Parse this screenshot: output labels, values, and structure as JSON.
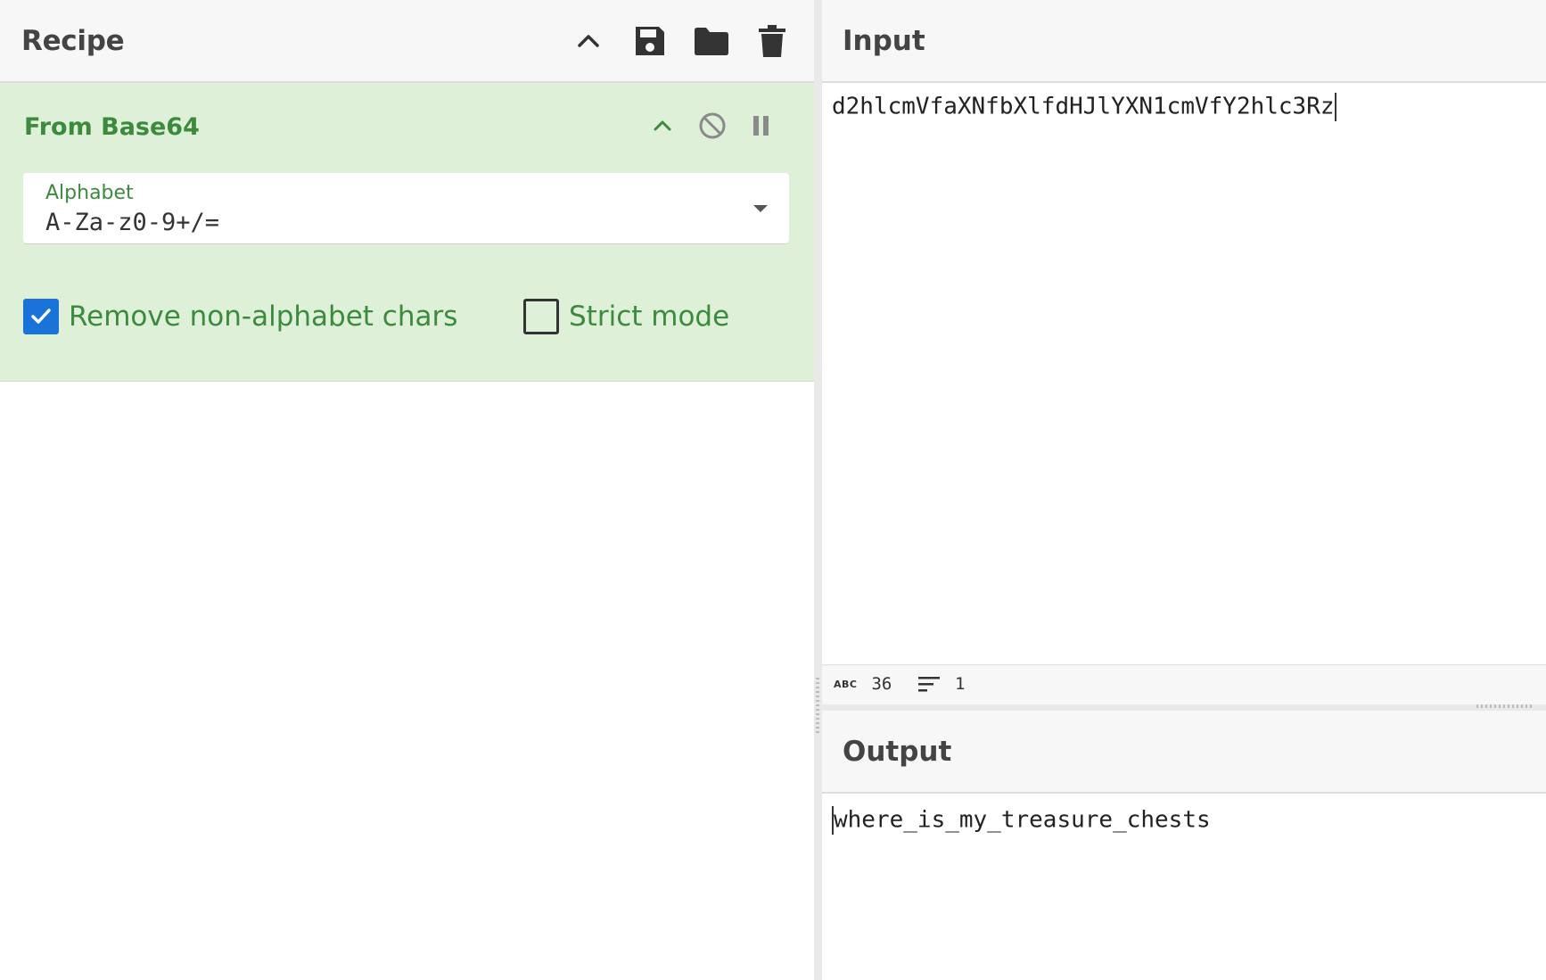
{
  "recipe": {
    "title": "Recipe",
    "header_icons": [
      "chevron-up-icon",
      "save-icon",
      "folder-icon",
      "trash-icon"
    ]
  },
  "operation": {
    "name": "From Base64",
    "icons": [
      "chevron-up-icon",
      "disable-icon",
      "pause-icon"
    ],
    "alphabet_label": "Alphabet",
    "alphabet_value": "A-Za-z0-9+/=",
    "remove_nonalphabet_label": "Remove non-alphabet chars",
    "remove_nonalphabet_checked": true,
    "strict_mode_label": "Strict mode",
    "strict_mode_checked": false,
    "colors": {
      "background": "#dff0d8",
      "text": "#3c8a3e",
      "checkbox": "#1a73d9"
    }
  },
  "input": {
    "title": "Input",
    "text": "d2hlcmVfaXNfbXlfdHJlYXN1cmVfY2hlc3Rz",
    "char_count": "36",
    "line_count": "1",
    "char_icon": "ABC",
    "lines_icon": "lines-icon"
  },
  "output": {
    "title": "Output",
    "text": "where_is_my_treasure_chests"
  }
}
